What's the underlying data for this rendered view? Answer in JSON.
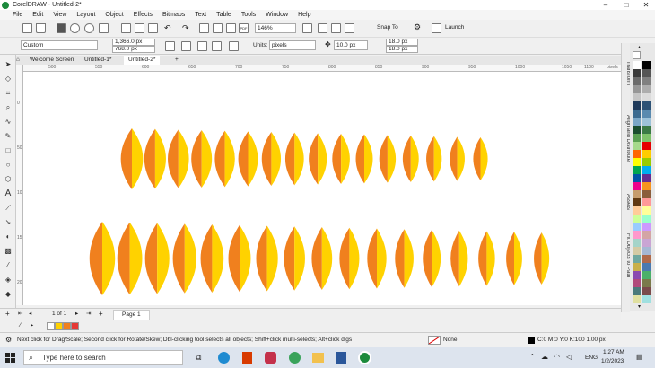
{
  "window": {
    "title": "CorelDRAW - Untitled-2*",
    "controls": [
      "–",
      "□",
      "✕"
    ]
  },
  "menu": [
    "File",
    "Edit",
    "View",
    "Layout",
    "Object",
    "Effects",
    "Bitmaps",
    "Text",
    "Table",
    "Tools",
    "Window",
    "Help"
  ],
  "toolbar": {
    "zoom": "146%",
    "snap_to": "Snap To",
    "launch": "Launch"
  },
  "propertybar": {
    "preset": "Custom",
    "width": "1,366.0 px",
    "height": "768.0 px",
    "units_label": "Units:",
    "units": "pixels",
    "nudge": "10.0 px",
    "dup_x": "18.0 px",
    "dup_y": "18.0 px"
  },
  "tabs": [
    "Welcome Screen",
    "Untitled-1*",
    "Untitled-2*"
  ],
  "ruler": {
    "h_ticks": [
      "500",
      "550",
      "600",
      "650",
      "700",
      "750",
      "800",
      "850",
      "900",
      "950",
      "1000",
      "1050",
      "1100",
      "1150"
    ],
    "unit": "pixels",
    "v_ticks": [
      "0",
      "50",
      "100",
      "150",
      "200"
    ]
  },
  "shapes": {
    "colors": {
      "orange": "#f0801e",
      "yellow": "#ffd200"
    },
    "row1_count": 16,
    "row2_count": 17
  },
  "dockers": [
    "Transform",
    "Align and Distribute",
    "Assets",
    "Fit Objects to Path"
  ],
  "palette": [
    "#ffffff",
    "#000000",
    "#3a3a3a",
    "#555555",
    "#6b6b6b",
    "#808080",
    "#969696",
    "#adadad",
    "#c4c4c4",
    "#dbdbdb",
    "#1f3a5a",
    "#2d5276",
    "#3b6a8f",
    "#5a8aaf",
    "#7aa6c6",
    "#9dc2d9",
    "#1a4d2e",
    "#3b7a45",
    "#5aa052",
    "#7fc26a",
    "#a6d98c",
    "#e60000",
    "#ff6600",
    "#ffcc00",
    "#ffff00",
    "#99cc00",
    "#00a651",
    "#00aeef",
    "#0054a6",
    "#662d91",
    "#ec008c",
    "#f7941d",
    "#c69c6d",
    "#8b5e3c",
    "#603913",
    "#ff9999",
    "#ffcc99",
    "#ffff99",
    "#ccff99",
    "#99ffcc",
    "#99ccff",
    "#cc99ff",
    "#ff99cc",
    "#d4a5a5",
    "#a5d4c9",
    "#c9a5d4",
    "#d4cba5",
    "#a5b8d4",
    "#6fa8a0",
    "#b06a4a",
    "#c8b04a",
    "#4a7ab0",
    "#8a4ab0",
    "#4ab06a",
    "#b04a7a",
    "#7a7a4a",
    "#4a7a7a",
    "#7a4a4a",
    "#e0e0a0",
    "#a0e0e0"
  ],
  "pagenav": {
    "counter": "1 of 1",
    "page": "Page 1"
  },
  "docpalette": [
    "#ffffff",
    "#ffd200",
    "#f0801e",
    "#e53935"
  ],
  "status": {
    "hint": "Next click for Drag/Scale; Second click for Rotate/Skew; Dbl-clicking tool selects all objects; Shift+click multi-selects; Alt+click digs",
    "fill": "None",
    "outline": "C:0 M:0 Y:0 K:100  1.00 px"
  },
  "taskbar": {
    "search_placeholder": "Type here to search",
    "lang": "ENG",
    "time": "1:27 AM",
    "date": "1/2/2023"
  }
}
